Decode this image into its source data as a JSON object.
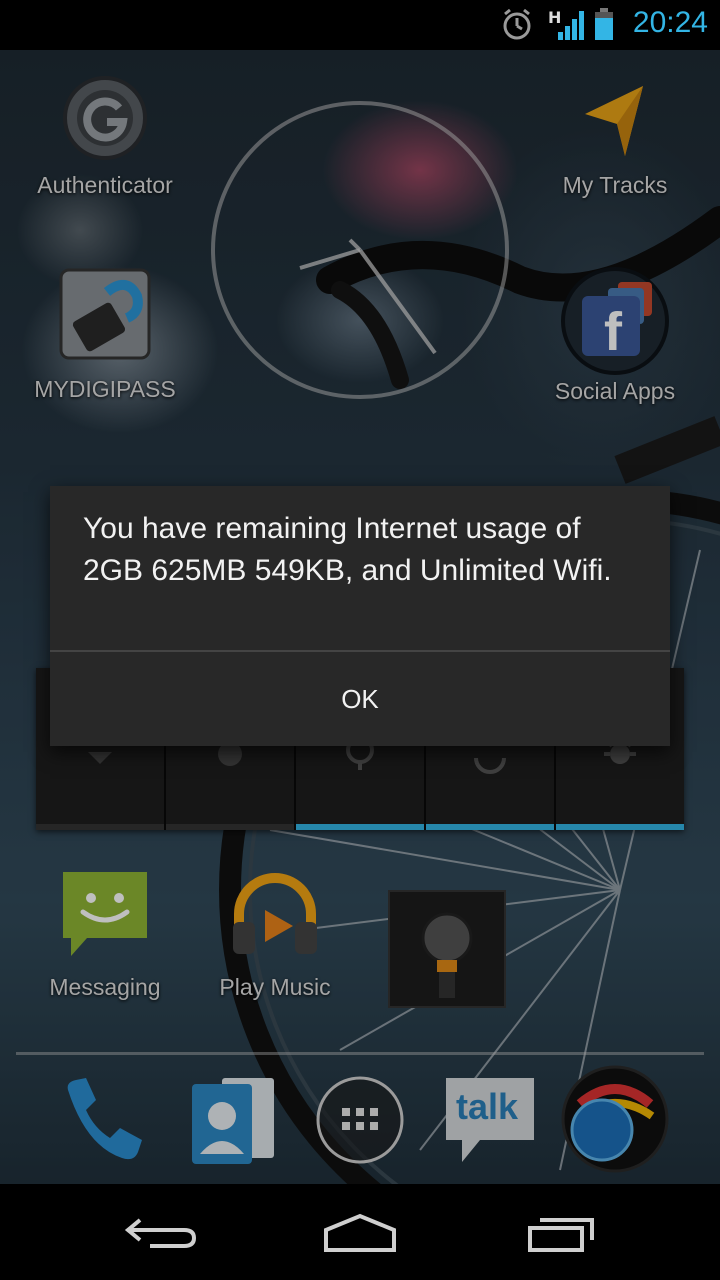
{
  "status_bar": {
    "time": "20:24",
    "icons": [
      "alarm-icon",
      "hspa-icon",
      "signal-icon",
      "battery-icon"
    ],
    "network_type": "H",
    "accent_color": "#33b5e5"
  },
  "home": {
    "apps": [
      {
        "label": "Authenticator",
        "icon": "authenticator-icon"
      },
      {
        "label": "My Tracks",
        "icon": "my-tracks-icon"
      },
      {
        "label": "MYDIGIPASS",
        "icon": "mydigipass-icon"
      },
      {
        "label": "Social Apps",
        "icon": "social-apps-folder-icon"
      },
      {
        "label": "Messaging",
        "icon": "messaging-icon"
      },
      {
        "label": "Play Music",
        "icon": "play-music-icon"
      }
    ],
    "power_widget": {
      "toggles": [
        {
          "name": "wifi",
          "on": false
        },
        {
          "name": "bluetooth",
          "on": false
        },
        {
          "name": "gps",
          "on": true
        },
        {
          "name": "sync",
          "on": true
        },
        {
          "name": "brightness",
          "on": true
        }
      ]
    }
  },
  "dialog": {
    "message": "You have remaining Internet usage of 2GB 625MB 549KB, and Unlimited Wifi.",
    "ok_label": "OK"
  },
  "dock": {
    "items": [
      "phone-icon",
      "contacts-icon",
      "app-drawer-icon",
      "talk-icon",
      "browser-icon"
    ],
    "talk_text": "talk"
  },
  "nav_bar": {
    "buttons": [
      "back-button",
      "home-button",
      "recents-button"
    ]
  }
}
